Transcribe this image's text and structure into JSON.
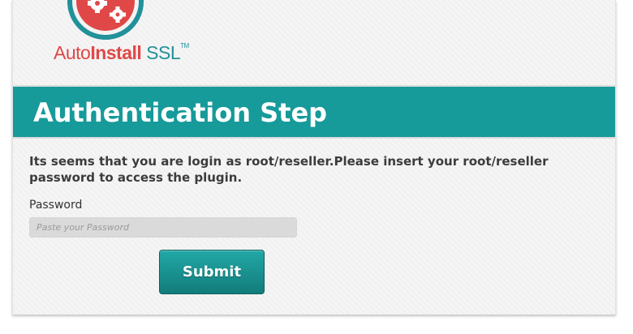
{
  "brand": {
    "part1": "Auto",
    "part2": "Install",
    "part3": " SSL",
    "tm": "TM",
    "colors": {
      "red": "#e04848",
      "teal": "#21919a"
    }
  },
  "header": {
    "title": "Authentication Step",
    "color": "#169a9a"
  },
  "form": {
    "message": "Its seems that you are login as root/reseller.Please insert your root/reseller password to access the plugin.",
    "password_label": "Password",
    "password_placeholder": "Paste your Password",
    "password_value": "",
    "submit_label": "Submit"
  },
  "icons": {
    "logo": "gear-shield-logo-icon"
  }
}
